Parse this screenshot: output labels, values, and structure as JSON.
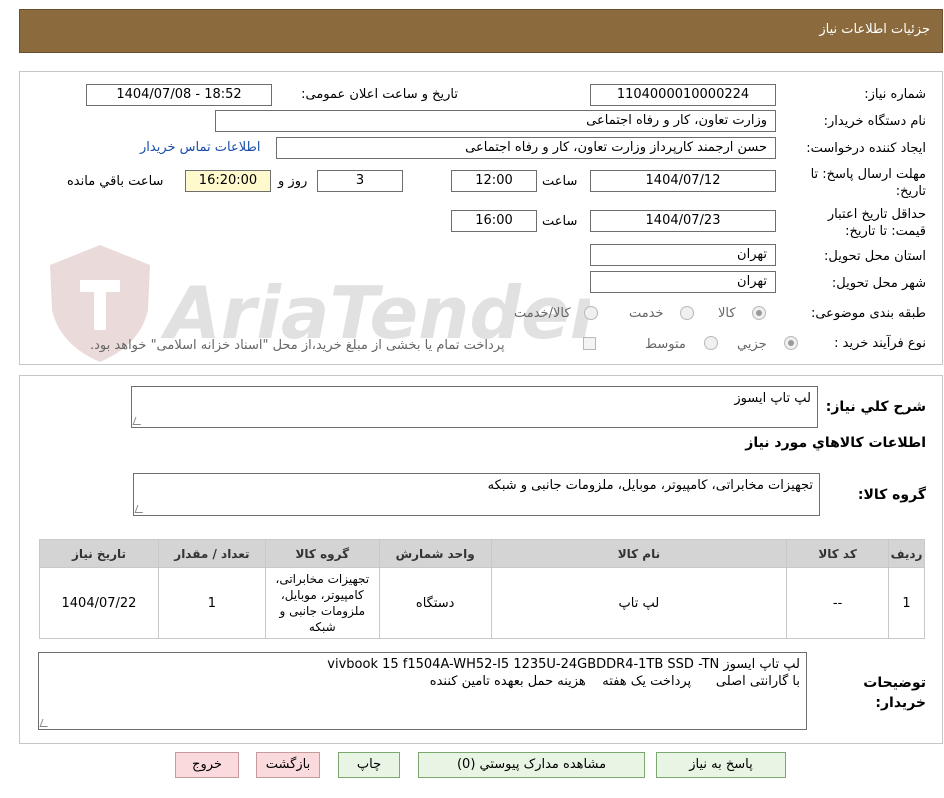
{
  "header": {
    "title": "جزئیات اطلاعات نیاز"
  },
  "form": {
    "need_number": {
      "label": "شماره نیاز:",
      "value": "1104000010000224"
    },
    "announce_datetime": {
      "label": "تاریخ و ساعت اعلان عمومی:",
      "value": "1404/07/08 - 18:52"
    },
    "buyer_org": {
      "label": "نام دستگاه خریدار:",
      "value": "وزارت تعاون، کار و رفاه اجتماعی"
    },
    "requester": {
      "label": "ایجاد کننده درخواست:",
      "value": "حسن ارجمند کارپرداز وزارت تعاون، کار و رفاه اجتماعی",
      "contact_link": "اطلاعات تماس خریدار"
    },
    "reply_deadline": {
      "label": "مهلت ارسال پاسخ: تا تاریخ:",
      "date": "1404/07/12",
      "time_label": "ساعت",
      "time": "12:00",
      "days": "3",
      "days_label": "روز و",
      "remaining": "16:20:00",
      "remaining_label": "ساعت باقي مانده"
    },
    "price_validity": {
      "label": "حداقل تاریخ اعتبار قیمت: تا تاریخ:",
      "date": "1404/07/23",
      "time_label": "ساعت",
      "time": "16:00"
    },
    "province": {
      "label": "استان محل تحویل:",
      "value": "تهران"
    },
    "city": {
      "label": "شهر محل تحویل:",
      "value": "تهران"
    },
    "category": {
      "label": "طبقه بندی موضوعی:",
      "options": [
        "کالا",
        "خدمت",
        "کالا/خدمت"
      ],
      "selected": "کالا"
    },
    "purchase_type": {
      "label": "نوع فرآیند خرید :",
      "options": [
        "جزیي",
        "متوسط"
      ],
      "selected": "جزیي",
      "note": "پرداخت تمام یا بخشی از مبلغ خرید،از محل \"اسناد خزانه اسلامی\" خواهد بود."
    }
  },
  "watermark": {
    "text": "AriaTender.neT"
  },
  "summary": {
    "label": "شرح کلي نياز:",
    "value": "لپ تاپ ایسوز",
    "goods_info_title": "اطلاعات کالاهاي مورد نياز",
    "goods_group_label": "گروه کالا:",
    "goods_group_value": "تجهیزات مخابراتی، کامپیوتر، موبایل، ملزومات جانبی و شبکه"
  },
  "table": {
    "columns": [
      "رديف",
      "کد کالا",
      "نام کالا",
      "واحد شمارش",
      "گروه کالا",
      "تعداد / مقدار",
      "تاريخ نياز"
    ],
    "rows": [
      [
        "1",
        "--",
        "لپ تاپ",
        "دستگاه",
        "تجهیزات مخابراتی، کامپیوتر، موبایل، ملزومات جانبی و شبکه",
        "1",
        "1404/07/22"
      ]
    ]
  },
  "buyer_notes": {
    "label": "توضيحات خريدار:",
    "line1": "لپ تاپ ایسوز vivbook 15 f1504A-WH52-I5 1235U-24GBDDR4-1TB SSD -TN",
    "line2": "با گارانتی اصلی      پرداخت یک هفته    هزینه حمل بعهده تامین کننده"
  },
  "buttons": {
    "reply": "پاسخ به نیاز",
    "attachments": "مشاهده مدارک پیوستي (0)",
    "print": "چاپ",
    "back": "بازگشت",
    "exit": "خروج"
  }
}
